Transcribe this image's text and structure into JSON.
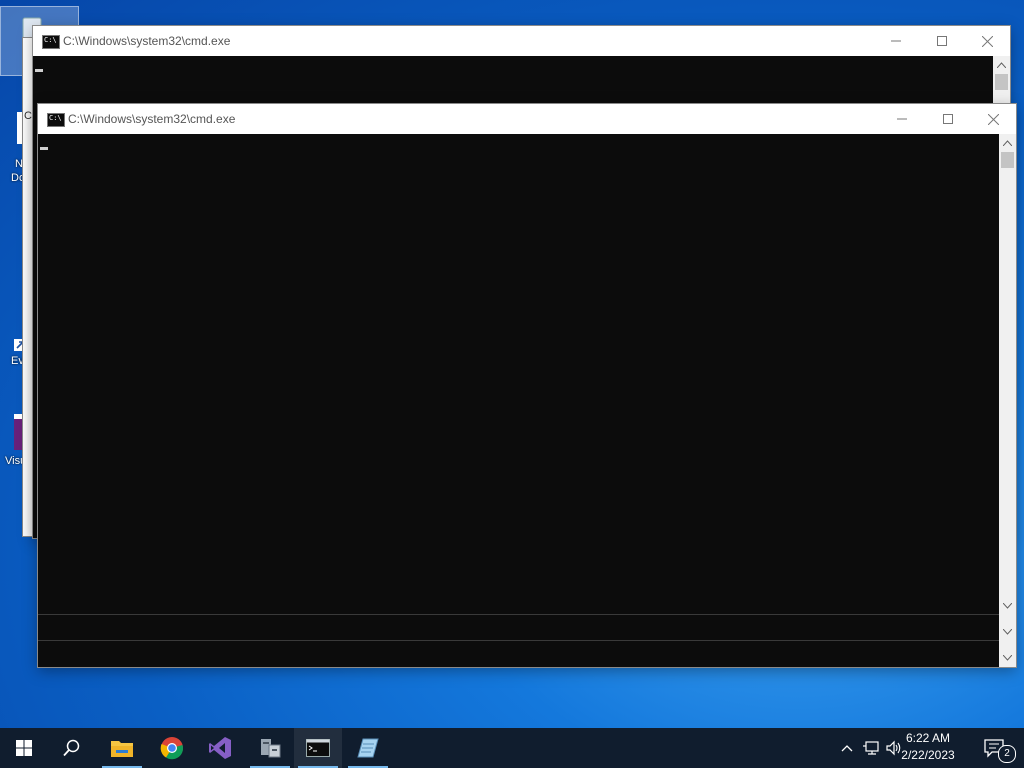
{
  "desktop": {
    "icons": [
      {
        "name": "recycle-bin",
        "label": "C"
      },
      {
        "name": "new-doc",
        "label": "N"
      },
      {
        "name": "new-doc-line2",
        "label": "Do"
      },
      {
        "name": "event-viewer",
        "label": "Ev"
      },
      {
        "name": "visual-studio",
        "label": "Visu"
      }
    ]
  },
  "windows": [
    {
      "title": "C:\\Windows\\system32\\cmd.exe"
    },
    {
      "title": "C:\\Windows\\system32\\cmd.exe"
    }
  ],
  "behind_window_fragment": {
    "label": "C"
  },
  "taskbar": {
    "items": [
      {
        "name": "start-button",
        "icon": "windows-logo-icon"
      },
      {
        "name": "search-button",
        "icon": "search-icon"
      },
      {
        "name": "file-explorer",
        "icon": "folder-icon"
      },
      {
        "name": "chrome",
        "icon": "chrome-icon"
      },
      {
        "name": "visual-studio",
        "icon": "visual-studio-icon"
      },
      {
        "name": "server-manager",
        "icon": "server-manager-icon"
      },
      {
        "name": "command-prompt",
        "icon": "cmd-icon"
      },
      {
        "name": "notepad",
        "icon": "notepad-icon"
      }
    ],
    "clock": {
      "time": "6:22 AM",
      "date": "2/22/2023"
    },
    "notifications": {
      "count": "2"
    }
  },
  "colors": {
    "console_bg": "#0c0c0c",
    "taskbar_bg": "#101d2e",
    "accent": "#76b9ed"
  }
}
